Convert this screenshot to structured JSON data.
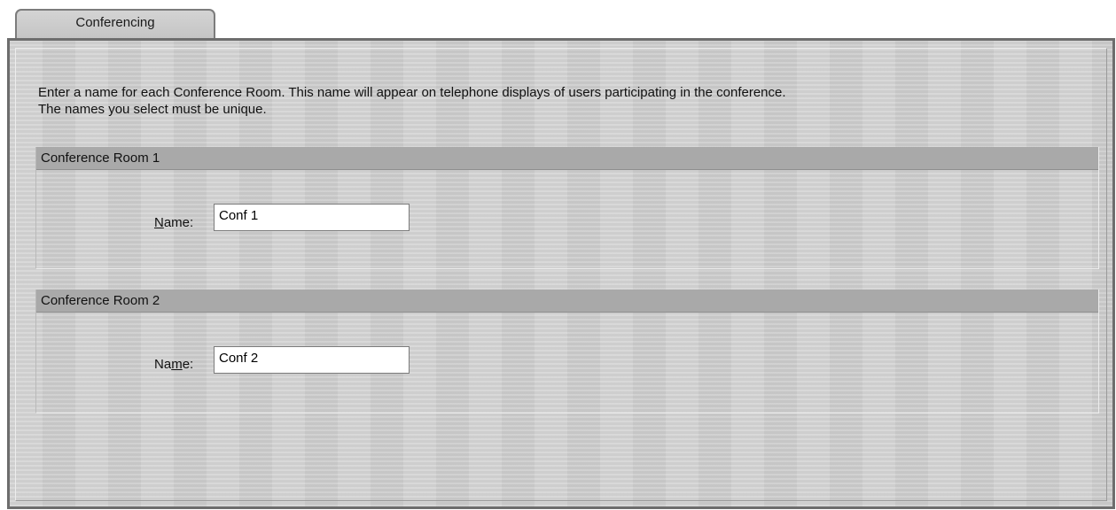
{
  "tabs": [
    {
      "label": "Conferencing",
      "active": true
    }
  ],
  "intro": {
    "line1": "Enter a name for each Conference Room. This name will appear on telephone displays of users participating in the conference.",
    "line2": "The names you select must be unique."
  },
  "rooms": [
    {
      "title": "Conference Room 1",
      "label_prefix": "",
      "label_mnemonic": "N",
      "label_suffix": "ame:",
      "value": "Conf 1"
    },
    {
      "title": "Conference Room 2",
      "label_prefix": "Na",
      "label_mnemonic": "m",
      "label_suffix": "e:",
      "value": "Conf 2"
    }
  ],
  "colors": {
    "panel_bg": "#d3d3d3",
    "section_header_bg": "#a9a9a9",
    "border": "#6d6d6d"
  }
}
